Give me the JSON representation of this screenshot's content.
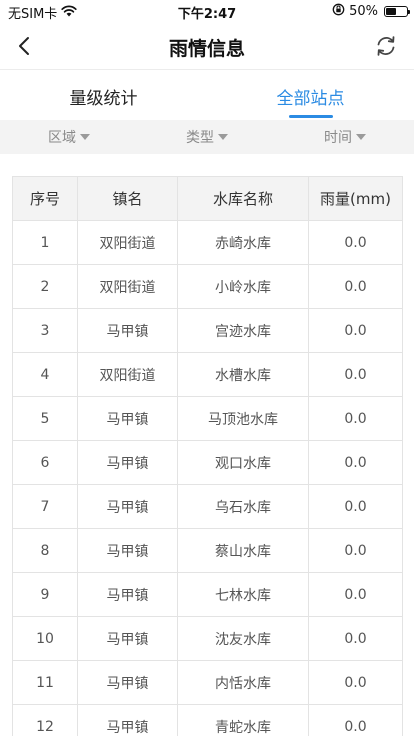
{
  "status_bar": {
    "carrier": "无SIM卡",
    "time": "下午2:47",
    "battery_percent": "50%",
    "battery_level": 0.5
  },
  "nav": {
    "title": "雨情信息"
  },
  "tabs": [
    {
      "label": "量级统计",
      "active": false
    },
    {
      "label": "全部站点",
      "active": true
    }
  ],
  "filters": [
    {
      "label": "区域"
    },
    {
      "label": "类型"
    },
    {
      "label": "时间"
    }
  ],
  "table": {
    "headers": [
      "序号",
      "镇名",
      "水库名称",
      "雨量(mm)"
    ],
    "rows": [
      [
        "1",
        "双阳街道",
        "赤崎水库",
        "0.0"
      ],
      [
        "2",
        "双阳街道",
        "小岭水库",
        "0.0"
      ],
      [
        "3",
        "马甲镇",
        "宫迹水库",
        "0.0"
      ],
      [
        "4",
        "双阳街道",
        "水槽水库",
        "0.0"
      ],
      [
        "5",
        "马甲镇",
        "马顶池水库",
        "0.0"
      ],
      [
        "6",
        "马甲镇",
        "观口水库",
        "0.0"
      ],
      [
        "7",
        "马甲镇",
        "乌石水库",
        "0.0"
      ],
      [
        "8",
        "马甲镇",
        "蔡山水库",
        "0.0"
      ],
      [
        "9",
        "马甲镇",
        "七林水库",
        "0.0"
      ],
      [
        "10",
        "马甲镇",
        "沈友水库",
        "0.0"
      ],
      [
        "11",
        "马甲镇",
        "内恬水库",
        "0.0"
      ],
      [
        "12",
        "马甲镇",
        "青蛇水库",
        "0.0"
      ]
    ]
  },
  "colors": {
    "accent": "#2b8be3"
  },
  "icons": {
    "back": "chevron-left-icon",
    "refresh": "refresh-icon",
    "wifi": "wifi-icon",
    "lock": "orientation-lock-icon",
    "battery": "battery-icon"
  }
}
